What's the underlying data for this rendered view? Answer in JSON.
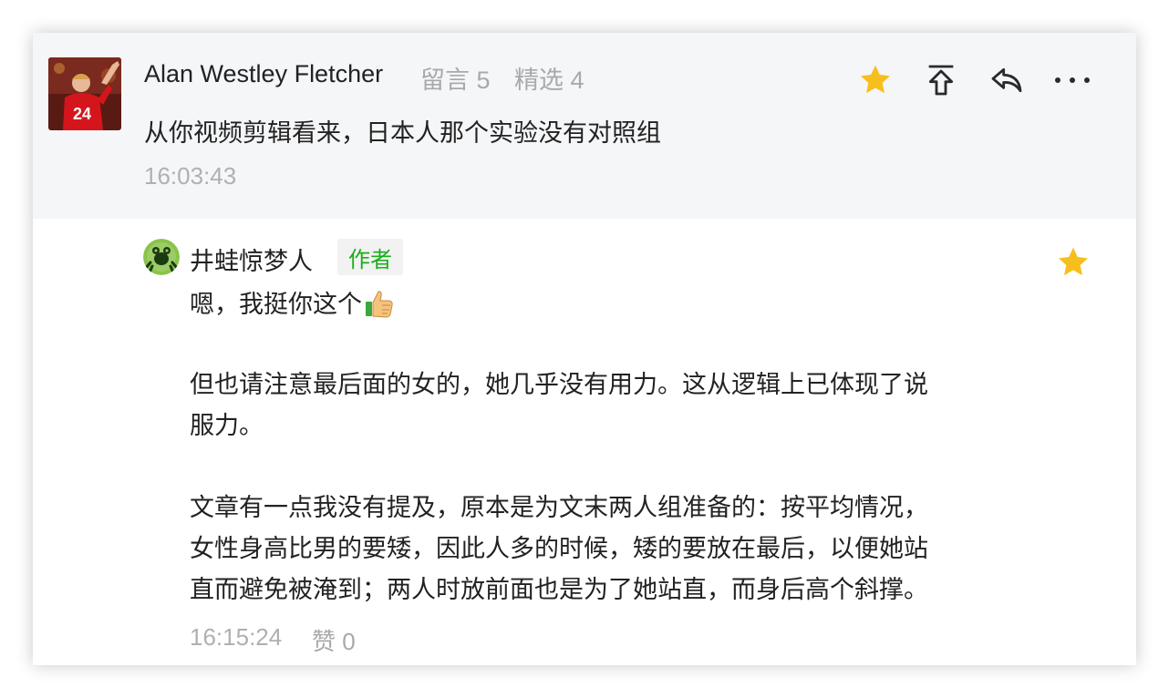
{
  "comment": {
    "user_name": "Alan Westley Fletcher",
    "messages_label": "留言 5",
    "featured_label": "精选 4",
    "text": "从你视频剪辑看来，日本人那个实验没有对照组",
    "time": "16:03:43",
    "avatar_jersey_number": "24",
    "actions": [
      "star-icon",
      "pin-top-icon",
      "reply-icon",
      "more-icon"
    ]
  },
  "reply": {
    "user_name": "井蛙惊梦人",
    "badge": "作者",
    "paragraphs": [
      "嗯，我挺你这个",
      "但也请注意最后面的女的，她几乎没有用力。这从逻辑上已体现了说",
      "服力。",
      "文章有一点我没有提及，原本是为文末两人组准备的：按平均情况，",
      "女性身高比男的要矮，因此人多的时候，矮的要放在最后，以便她站",
      "直而避免被淹到；两人时放前面也是为了她站直，而身后高个斜撑。"
    ],
    "time": "16:15:24",
    "likes_label": "赞 0"
  },
  "colors": {
    "star": "#f7bf1d",
    "author_badge_text": "#1aad19",
    "header_bg": "#f5f6f8",
    "muted_text": "#b0b0b0"
  }
}
